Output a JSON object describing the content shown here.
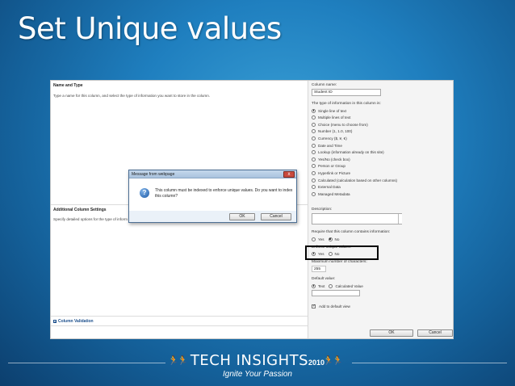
{
  "slide": {
    "title": "Set Unique values",
    "brand_name": "TECH INSIGHTS",
    "brand_year": "2010",
    "tagline": "Ignite Your Passion"
  },
  "form": {
    "name_section": {
      "heading": "Name and Type",
      "description": "Type a name for this column, and select the type of information you want to store in the column."
    },
    "additional_section": {
      "heading": "Additional Column Settings",
      "description": "Specify detailed options for the type of inform"
    },
    "column_validation": "Column Validation",
    "column_name_label": "Column name:",
    "column_name_value": "Student ID",
    "type_label": "The type of information in this column is:",
    "types": [
      "Single line of text",
      "Multiple lines of text",
      "Choice (menu to choose from)",
      "Number (1, 1.0, 100)",
      "Currency ($, ¥, €)",
      "Date and Time",
      "Lookup (information already on this site)",
      "Yes/No (check box)",
      "Person or Group",
      "Hyperlink or Picture",
      "Calculated (calculation based on other columns)",
      "External Data",
      "Managed Metadata"
    ],
    "description_label": "Description:",
    "require_label": "Require that this column contains information:",
    "require_yes": "Yes",
    "require_no": "No",
    "unique_label": "Enforce unique values:",
    "unique_yes": "Yes",
    "unique_no": "No",
    "max_chars_label": "Maximum number of characters:",
    "max_chars_value": "255",
    "default_label": "Default value:",
    "default_text": "Text",
    "default_calculated": "Calculated Value",
    "add_to_view": "Add to default view",
    "ok": "OK",
    "cancel": "Cancel"
  },
  "dialog": {
    "title": "Message from webpage",
    "close": "x",
    "icon_glyph": "?",
    "message": "This column must be indexed to enforce unique values. Do you want to index this column?",
    "ok": "OK",
    "cancel": "Cancel"
  }
}
